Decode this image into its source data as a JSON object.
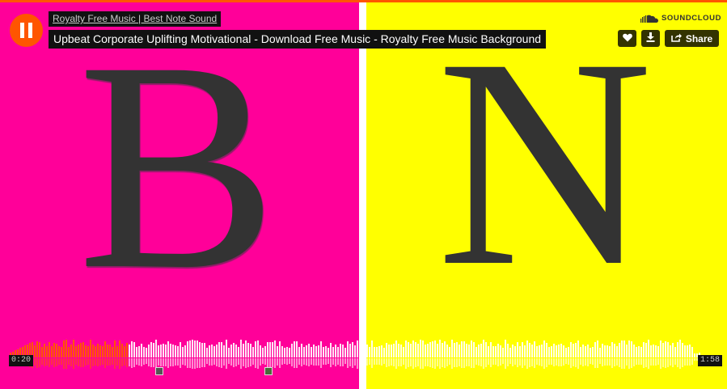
{
  "artwork": {
    "left_letter": "B",
    "right_letter": "N",
    "left_color": "#ff0099",
    "right_color": "#ffff00"
  },
  "player": {
    "state": "playing",
    "pause_icon": "pause-icon",
    "uploader": "Royalty Free Music | Best Note Sound",
    "title": "Upbeat Corporate Uplifting Motivational - Download Free Music - Royalty Free Music Background",
    "brand": "SOUNDCLOUD",
    "brand_icon": "soundcloud-cloud-icon",
    "accent_color": "#ff5500"
  },
  "actions": {
    "like_icon": "heart-icon",
    "download_icon": "download-icon",
    "share_icon": "share-icon",
    "share_label": "Share"
  },
  "progress": {
    "current_time": "0:20",
    "total_time": "1:58",
    "played_fraction": 0.17,
    "comment_markers": 2
  }
}
